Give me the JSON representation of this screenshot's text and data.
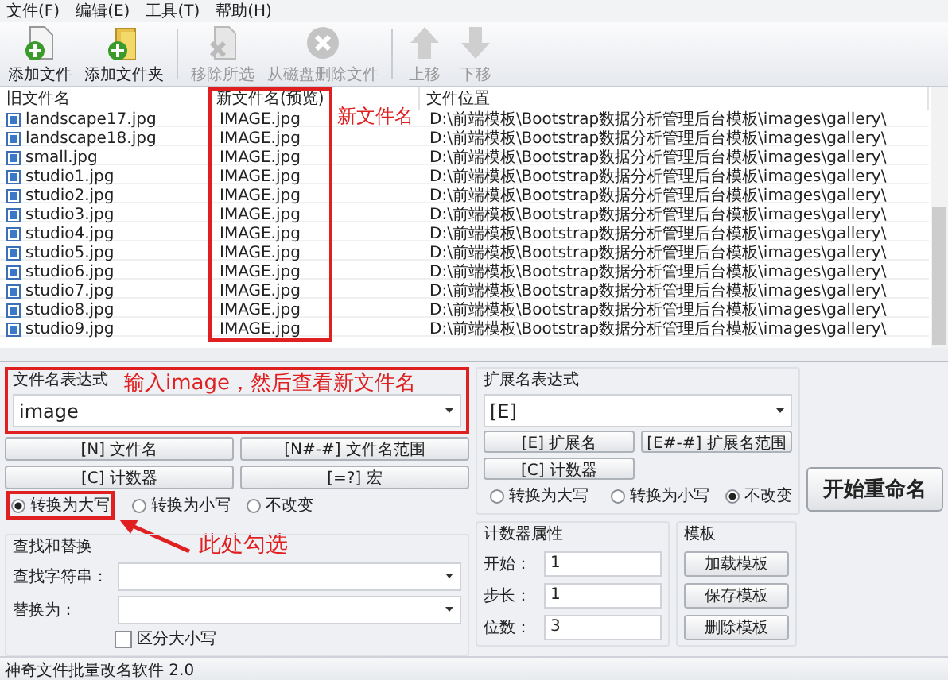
{
  "menu": [
    "文件(F)",
    "编辑(E)",
    "工具(T)",
    "帮助(H)"
  ],
  "toolbar": [
    {
      "label": "添加文件",
      "kind": "add-file",
      "disabled": false
    },
    {
      "label": "添加文件夹",
      "kind": "add-folder",
      "disabled": false
    },
    {
      "label": "移除所选",
      "kind": "remove",
      "disabled": true
    },
    {
      "label": "从磁盘删除文件",
      "kind": "delete",
      "disabled": true
    },
    {
      "label": "上移",
      "kind": "up",
      "disabled": true
    },
    {
      "label": "下移",
      "kind": "down",
      "disabled": true
    }
  ],
  "table": {
    "columns": [
      "旧文件名",
      "新文件名(预览)",
      "文件位置"
    ],
    "rows": [
      {
        "old": "landscape17.jpg",
        "new": "IMAGE.jpg",
        "location": "D:\\前端模板\\Bootstrap数据分析管理后台模板\\images\\gallery\\"
      },
      {
        "old": "landscape18.jpg",
        "new": "IMAGE.jpg",
        "location": "D:\\前端模板\\Bootstrap数据分析管理后台模板\\images\\gallery\\"
      },
      {
        "old": "small.jpg",
        "new": "IMAGE.jpg",
        "location": "D:\\前端模板\\Bootstrap数据分析管理后台模板\\images\\gallery\\"
      },
      {
        "old": "studio1.jpg",
        "new": "IMAGE.jpg",
        "location": "D:\\前端模板\\Bootstrap数据分析管理后台模板\\images\\gallery\\"
      },
      {
        "old": "studio2.jpg",
        "new": "IMAGE.jpg",
        "location": "D:\\前端模板\\Bootstrap数据分析管理后台模板\\images\\gallery\\"
      },
      {
        "old": "studio3.jpg",
        "new": "IMAGE.jpg",
        "location": "D:\\前端模板\\Bootstrap数据分析管理后台模板\\images\\gallery\\"
      },
      {
        "old": "studio4.jpg",
        "new": "IMAGE.jpg",
        "location": "D:\\前端模板\\Bootstrap数据分析管理后台模板\\images\\gallery\\"
      },
      {
        "old": "studio5.jpg",
        "new": "IMAGE.jpg",
        "location": "D:\\前端模板\\Bootstrap数据分析管理后台模板\\images\\gallery\\"
      },
      {
        "old": "studio6.jpg",
        "new": "IMAGE.jpg",
        "location": "D:\\前端模板\\Bootstrap数据分析管理后台模板\\images\\gallery\\"
      },
      {
        "old": "studio7.jpg",
        "new": "IMAGE.jpg",
        "location": "D:\\前端模板\\Bootstrap数据分析管理后台模板\\images\\gallery\\"
      },
      {
        "old": "studio8.jpg",
        "new": "IMAGE.jpg",
        "location": "D:\\前端模板\\Bootstrap数据分析管理后台模板\\images\\gallery\\"
      },
      {
        "old": "studio9.jpg",
        "new": "IMAGE.jpg",
        "location": "D:\\前端模板\\Bootstrap数据分析管理后台模板\\images\\gallery\\"
      }
    ]
  },
  "filename_expression": {
    "label": "文件名表达式",
    "value": "image",
    "buttons": [
      "[N] 文件名",
      "[N#-#] 文件名范围",
      "[C] 计数器",
      "[=?] 宏"
    ],
    "case_options": [
      {
        "label": "转换为大写",
        "selected": true
      },
      {
        "label": "转换为小写",
        "selected": false
      },
      {
        "label": "不改变",
        "selected": false
      }
    ]
  },
  "find_replace": {
    "title": "查找和替换",
    "find_label": "查找字符串：",
    "replace_label": "替换为：",
    "case_sensitive": {
      "label": "区分大小写",
      "checked": false
    }
  },
  "extension_expression": {
    "label": "扩展名表达式",
    "value": "[E]",
    "buttons": [
      "[E] 扩展名",
      "[E#-#] 扩展名范围",
      "[C] 计数器"
    ],
    "case_options": [
      {
        "label": "转换为大写",
        "selected": false
      },
      {
        "label": "转换为小写",
        "selected": false
      },
      {
        "label": "不改变",
        "selected": true
      }
    ]
  },
  "counter": {
    "title": "计数器属性",
    "fields": [
      {
        "label": "开始：",
        "value": "1"
      },
      {
        "label": "步长：",
        "value": "1"
      },
      {
        "label": "位数：",
        "value": "3"
      }
    ]
  },
  "templates": {
    "title": "模板",
    "buttons": [
      "加载模板",
      "保存模板",
      "删除模板"
    ]
  },
  "rename_button": "开始重命名",
  "status_bar": "神奇文件批量改名软件 2.0",
  "annotations": {
    "new_name_note": "新文件名",
    "expression_note": "输入image，然后查看新文件名",
    "radio_note": "此处勾选"
  }
}
